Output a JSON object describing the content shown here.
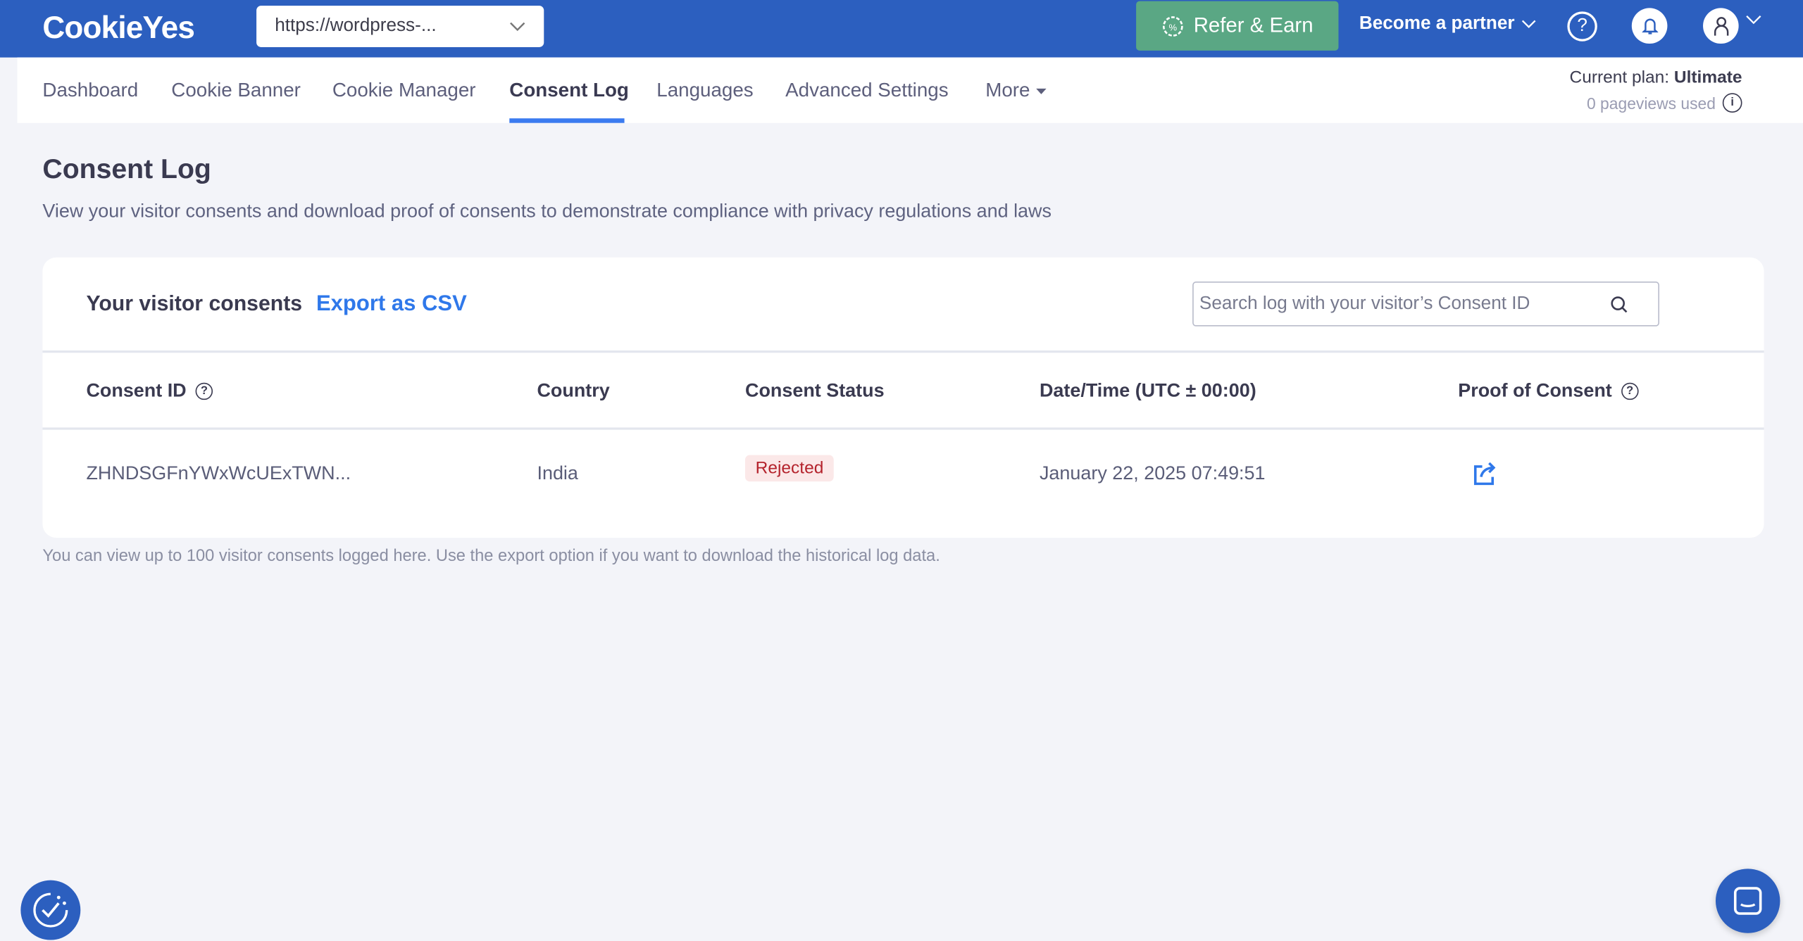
{
  "header": {
    "logo": "CookieYes",
    "site_select": "https://wordpress-...",
    "refer_label": "Refer & Earn",
    "partner_label": "Become a partner"
  },
  "nav": {
    "tabs": [
      "Dashboard",
      "Cookie Banner",
      "Cookie Manager",
      "Consent Log",
      "Languages",
      "Advanced Settings",
      "More"
    ],
    "active": "Consent Log",
    "plan_label": "Current plan:",
    "plan_value": "Ultimate",
    "pageviews": "0 pageviews used"
  },
  "page": {
    "title": "Consent Log",
    "description": "View your visitor consents and download proof of consents to demonstrate compliance with privacy regulations and laws"
  },
  "card": {
    "title": "Your visitor consents",
    "export_label": "Export as CSV",
    "search_placeholder": "Search log with your visitor’s Consent ID",
    "columns": [
      "Consent ID",
      "Country",
      "Consent Status",
      "Date/Time (UTC ± 00:00)",
      "Proof of Consent"
    ],
    "rows": [
      {
        "id": "ZHNDSGFnYWxWcUExTWN...",
        "country": "India",
        "status": "Rejected",
        "datetime": "January 22, 2025 07:49:51"
      }
    ]
  },
  "note": "You can view up to 100 visitor consents logged here. Use the export option if you want to download the historical log data.",
  "colors": {
    "header": "#2c5fbf",
    "refer": "#5aa784",
    "accent": "#3b7bf0",
    "rejected_bg": "#fbe8e8",
    "rejected_text": "#b4232c"
  }
}
